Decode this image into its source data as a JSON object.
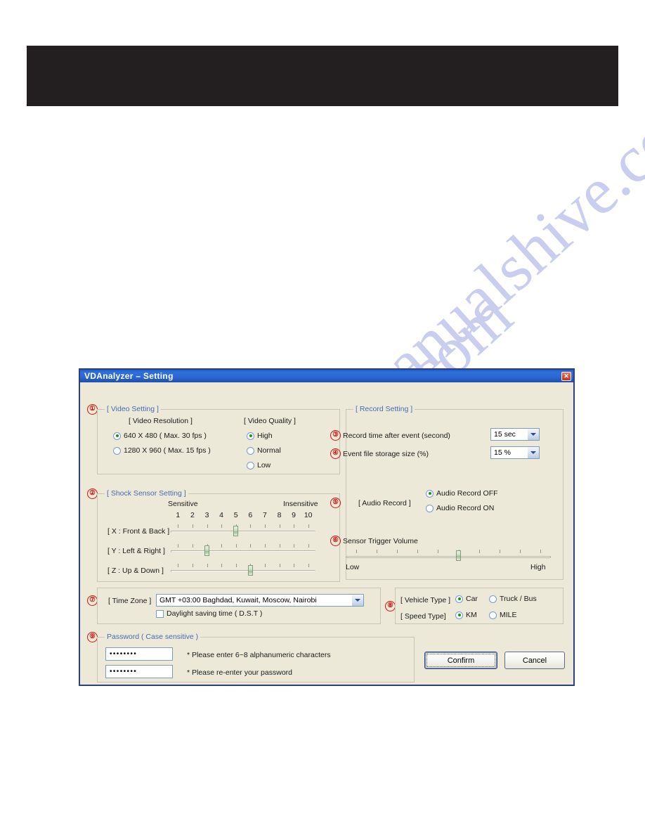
{
  "page": {
    "watermark_lines": [
      "manualshive.com",
      "manualshive.com"
    ]
  },
  "dialog": {
    "title": "VDAnalyzer – Setting",
    "close_icon": "close-icon",
    "sections": {
      "video": {
        "number": "①",
        "title": "[ Video Setting ]",
        "resolution_header": "[ Video Resolution ]",
        "resolution_options": [
          {
            "label": "640 X 480 ( Max. 30 fps )",
            "selected": true
          },
          {
            "label": "1280 X 960 ( Max. 15 fps )",
            "selected": false
          }
        ],
        "quality_header": "[ Video Quality ]",
        "quality_options": [
          {
            "label": "High",
            "selected": true
          },
          {
            "label": "Normal",
            "selected": false
          },
          {
            "label": "Low",
            "selected": false
          }
        ]
      },
      "shock": {
        "number": "②",
        "title": "[ Shock Sensor Setting ]",
        "left_label": "Sensitive",
        "right_label": "Insensitive",
        "scale": [
          "1",
          "2",
          "3",
          "4",
          "5",
          "6",
          "7",
          "8",
          "9",
          "10"
        ],
        "axes": [
          {
            "label": "[ X : Front & Back ]",
            "value": 5
          },
          {
            "label": "[ Y : Left & Right ]",
            "value": 3
          },
          {
            "label": "[ Z : Up & Down  ]",
            "value": 6
          }
        ]
      },
      "record": {
        "number_record_time": "③",
        "number_storage": "④",
        "title": "[ Record Setting ]",
        "record_time_label": "Record time after event (second)",
        "record_time_value": "15 sec",
        "storage_label": "Event file storage size (%)",
        "storage_value": "15 %"
      },
      "audio": {
        "number": "⑤",
        "label": "[ Audio Record ]",
        "options": [
          {
            "label": "Audio Record OFF",
            "selected": true
          },
          {
            "label": "Audio Record ON",
            "selected": false
          }
        ]
      },
      "volume": {
        "number": "⑥",
        "label": "Sensor Trigger Volume",
        "low_label": "Low",
        "high_label": "High",
        "value": 6,
        "min": 1,
        "max": 10
      },
      "timezone": {
        "number": "⑦",
        "label": "[ Time Zone ]",
        "value": "GMT +03:00 Baghdad, Kuwait, Moscow, Nairobi",
        "dst_label": "Daylight saving time ( D.S.T )",
        "dst_checked": false
      },
      "vehicle": {
        "number": "⑧",
        "vehicle_label": "[ Vehicle Type ]",
        "vehicle_options": [
          {
            "label": "Car",
            "selected": true
          },
          {
            "label": "Truck / Bus",
            "selected": false
          }
        ],
        "speed_label": "[ Speed  Type]",
        "speed_options": [
          {
            "label": "KM",
            "selected": true
          },
          {
            "label": "MILE",
            "selected": false
          }
        ]
      },
      "password": {
        "number": "⑨",
        "title": "Password ( Case sensitive )",
        "field1_value": "••••••••",
        "field1_hint": "* Please enter 6~8 alphanumeric characters",
        "field2_value": "••••••••",
        "field2_hint": "* Please re-enter your password"
      }
    },
    "buttons": {
      "confirm": "Confirm",
      "cancel": "Cancel"
    }
  },
  "colors": {
    "titlebar_blue": "#2c6ad2",
    "dialog_face": "#ece9d8",
    "group_title_blue": "#4a6ab0",
    "number_red": "#cc1111",
    "radio_dot_green": "#1b8f2e",
    "banner_black": "#231f20"
  }
}
